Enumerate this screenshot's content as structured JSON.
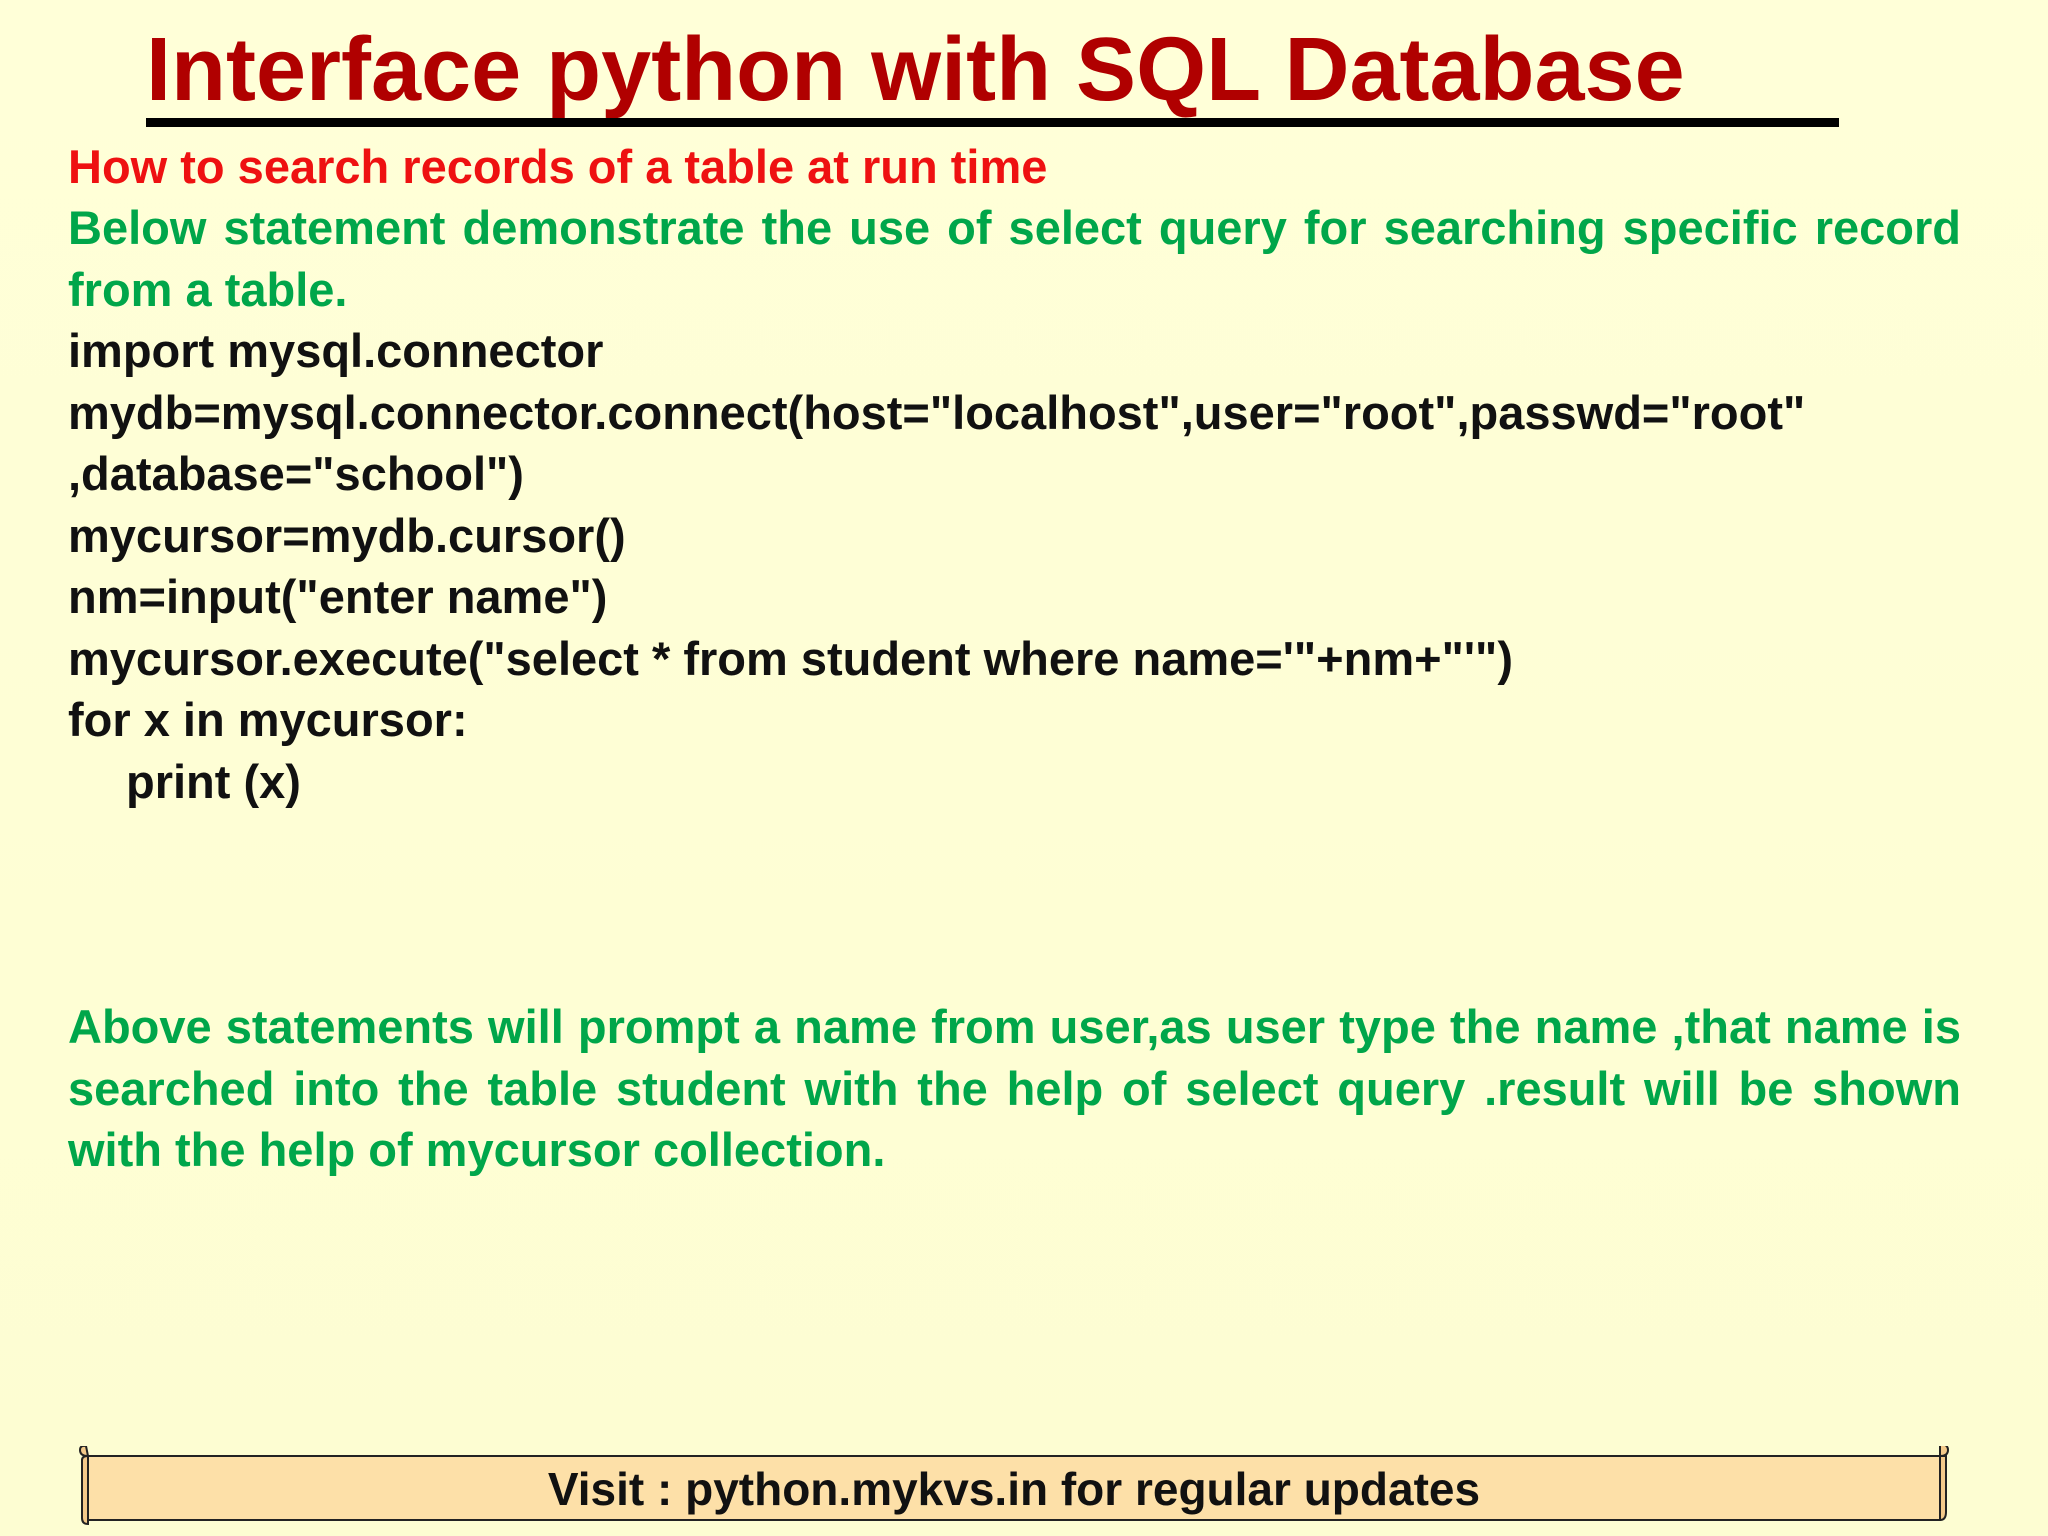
{
  "slide": {
    "title": "Interface python with SQL Database",
    "subheading": "How to search records of a table at run time",
    "intro": "Below statement demonstrate the use of select query for searching specific record from a table.",
    "code_lines": [
      "import mysql.connector",
      "mydb=mysql.connector.connect(host=\"localhost\",user=\"root\",passwd=\"root\"",
      ",database=\"school\")",
      "mycursor=mydb.cursor()",
      "nm=input(\"enter name\")",
      "mycursor.execute(\"select * from student where name='\"+nm+\"'\")",
      "for x in mycursor:",
      "print (x)"
    ],
    "outro": "Above statements will prompt a name from user,as user type the name ,that name is searched into the table student with the help of select query .result will be shown with the help of mycursor collection.",
    "footer_banner": "Visit : python.mykvs.in for regular updates"
  },
  "colors": {
    "background": "#ffffd6",
    "title": "#b00000",
    "subheading": "#ee1111",
    "description": "#00a64a",
    "code": "#111111",
    "banner_fill": "#fde0a8"
  }
}
